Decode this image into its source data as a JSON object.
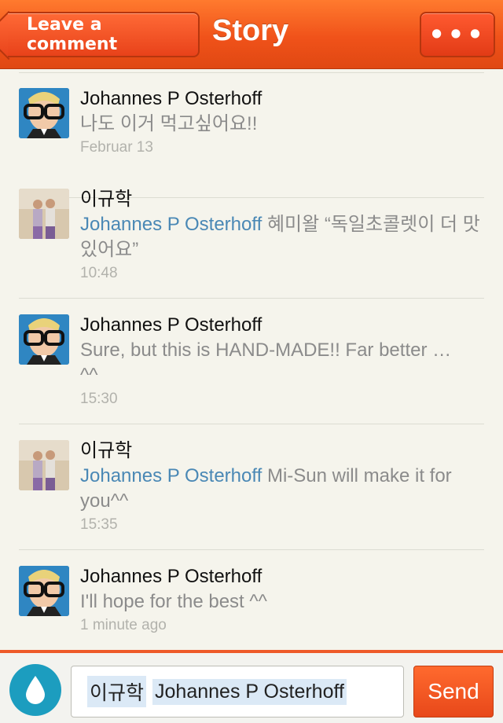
{
  "nav": {
    "back_label": "Leave a comment",
    "title": "Story",
    "more_label": "•••",
    "accent": "#f0521a"
  },
  "comments": [
    {
      "author": "Johannes P Osterhoff",
      "mention": "",
      "text": "나도 이거 먹고싶어요!!",
      "time": "Februar 13",
      "avatar": "avatar-glasses"
    },
    {
      "author": "이규학",
      "mention": "Johannes P Osterhoff",
      "text": " 혜미왈 “독일초콜렛이 더 맛있어요”",
      "time": "10:48",
      "avatar": "avatar-couple"
    },
    {
      "author": "Johannes P Osterhoff",
      "mention": "",
      "text": "Sure, but this is HAND-MADE!! Far better …",
      "text2": "^^",
      "time": "15:30",
      "avatar": "avatar-glasses"
    },
    {
      "author": "이규학",
      "mention": "Johannes P Osterhoff",
      "text": " Mi-Sun will make it for you^^",
      "time": "15:35",
      "avatar": "avatar-couple"
    },
    {
      "author": "Johannes P Osterhoff",
      "mention": "",
      "text": "I'll hope for the best ^^",
      "time": "1 minute ago",
      "avatar": "avatar-glasses"
    }
  ],
  "composer": {
    "chip1": "이규학",
    "chip2": "Johannes P Osterhoff",
    "send_label": "Send",
    "drop_icon": "water-drop-icon"
  }
}
